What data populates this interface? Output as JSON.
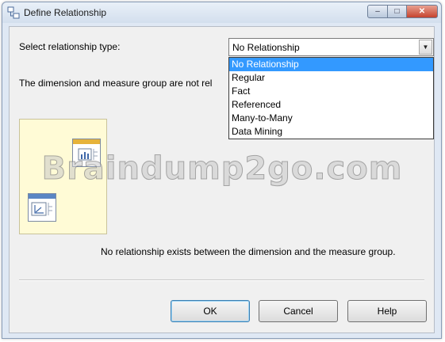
{
  "window": {
    "title": "Define Relationship",
    "controls": {
      "minimize": "–",
      "maximize": "□",
      "close": "✕"
    }
  },
  "form": {
    "relationship_type_label": "Select relationship type:",
    "relationship_type_value": "No Relationship",
    "dropdown_arrow": "▼",
    "dropdown_options": [
      "No Relationship",
      "Regular",
      "Fact",
      "Referenced",
      "Many-to-Many",
      "Data Mining"
    ],
    "selected_index": 0
  },
  "status_text": "The dimension and measure group are not rel",
  "diagram": {
    "measure_table_icon": "bar-chart-icon",
    "dimension_table_icon": "axis-chart-icon",
    "background_color": "#fffbd6"
  },
  "message": "No relationship exists between the dimension and the measure group.",
  "buttons": {
    "ok": "OK",
    "cancel": "Cancel",
    "help": "Help"
  },
  "watermark": "Braindump2go.com",
  "colors": {
    "selection": "#3399ff",
    "close_button": "#c5432e"
  }
}
